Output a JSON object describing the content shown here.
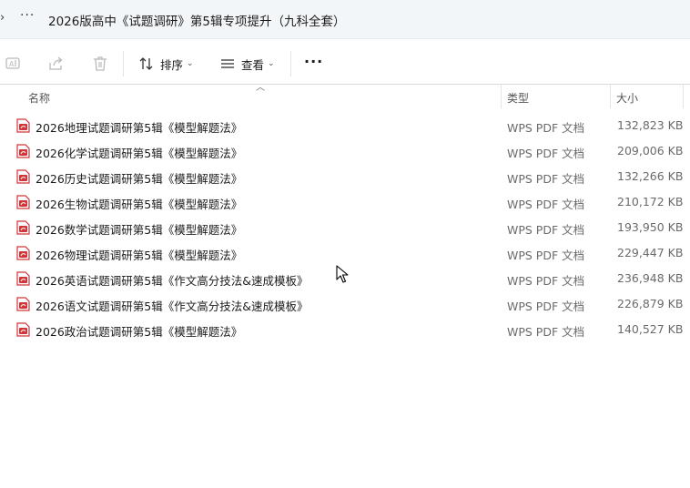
{
  "window": {
    "path_chevron": "›",
    "overflow": "···",
    "path": "2026版高中《试题调研》第5辑专项提升（九科全套）"
  },
  "toolbar": {
    "sort_label": "排序",
    "view_label": "查看",
    "more_label": "···"
  },
  "columns": {
    "name": "名称",
    "type": "类型",
    "size": "大小"
  },
  "files": [
    {
      "name": "2026地理试题调研第5辑《模型解题法》",
      "type": "WPS PDF 文档",
      "size": "132,823 KB"
    },
    {
      "name": "2026化学试题调研第5辑《模型解题法》",
      "type": "WPS PDF 文档",
      "size": "209,006 KB"
    },
    {
      "name": "2026历史试题调研第5辑《模型解题法》",
      "type": "WPS PDF 文档",
      "size": "132,266 KB"
    },
    {
      "name": "2026生物试题调研第5辑《模型解题法》",
      "type": "WPS PDF 文档",
      "size": "210,172 KB"
    },
    {
      "name": "2026数学试题调研第5辑《模型解题法》",
      "type": "WPS PDF 文档",
      "size": "193,950 KB"
    },
    {
      "name": "2026物理试题调研第5辑《模型解题法》",
      "type": "WPS PDF 文档",
      "size": "229,447 KB"
    },
    {
      "name": "2026英语试题调研第5辑《作文高分技法&速成模板》",
      "type": "WPS PDF 文档",
      "size": "236,948 KB"
    },
    {
      "name": "2026语文试题调研第5辑《作文高分技法&速成模板》",
      "type": "WPS PDF 文档",
      "size": "226,879 KB"
    },
    {
      "name": "2026政治试题调研第5辑《模型解题法》",
      "type": "WPS PDF 文档",
      "size": "140,527 KB"
    }
  ],
  "colors": {
    "pdf_icon": "#d13438",
    "pathbar_bg": "#f3f6f9"
  }
}
